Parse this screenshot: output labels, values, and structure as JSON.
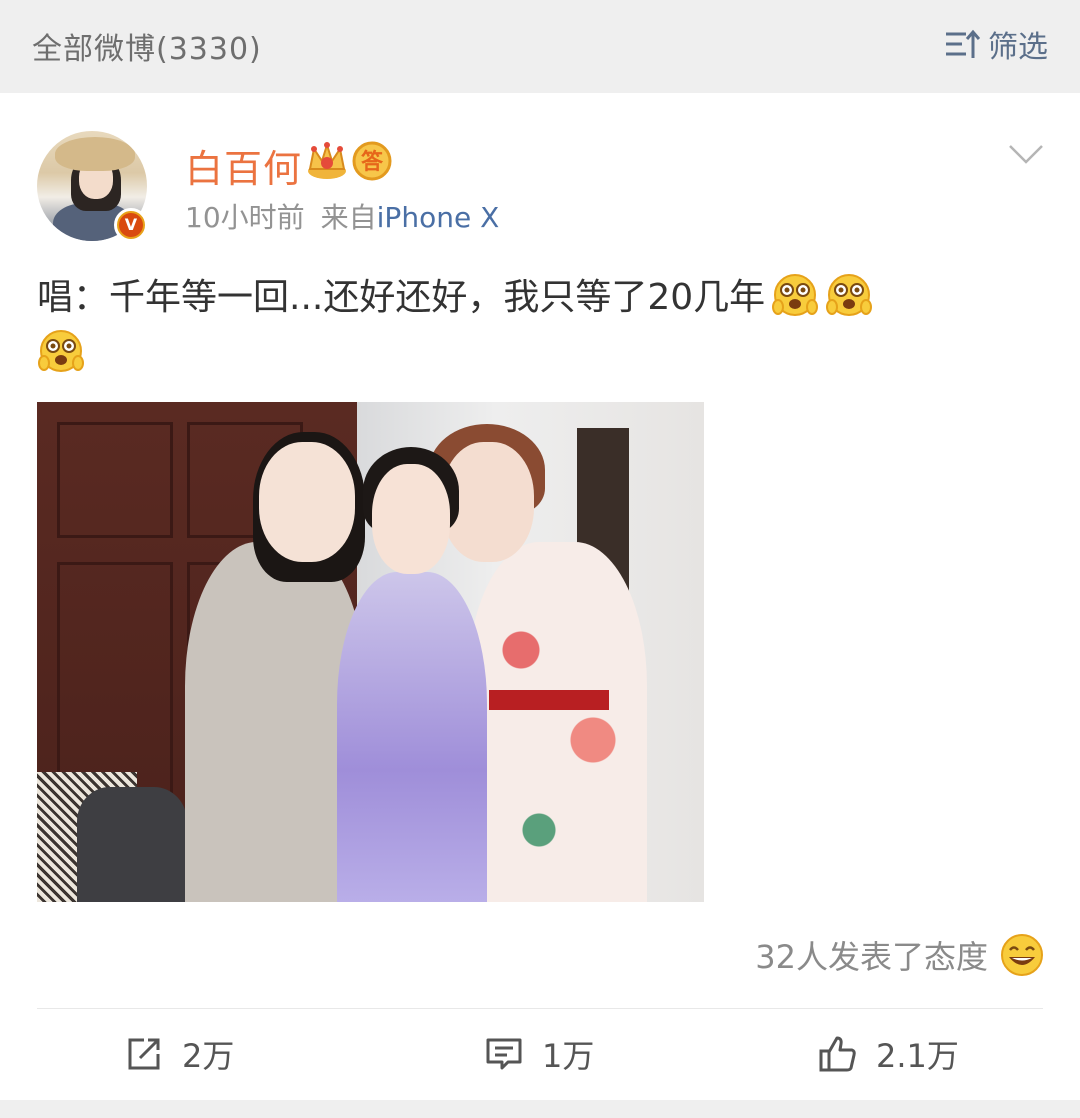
{
  "top_bar": {
    "count_label": "全部微博(3330)",
    "filter_label": "筛选",
    "filter_icon": "filter-sort-icon"
  },
  "post": {
    "author": "白百何",
    "badges": [
      "crown-icon",
      "answer-icon"
    ],
    "answer_badge_text": "答",
    "verified_badge": "V",
    "time": "10小时前",
    "source_prefix": "来自",
    "source": "iPhone X",
    "text": "唱：千年等一回...还好还好，我只等了20几年",
    "emoji": "shocked-grin-emoji",
    "emoji_count": 3,
    "attitude_text": "32人发表了态度",
    "attitude_icon": "laughing-emoji"
  },
  "actions": {
    "repost_count": "2万",
    "comment_count": "1万",
    "like_count": "2.1万"
  },
  "colors": {
    "username": "#eb7340",
    "source": "#4a6fa5",
    "filter": "#5b6f8a",
    "meta": "#939393",
    "text": "#333333",
    "topbar_bg": "#efefef"
  }
}
